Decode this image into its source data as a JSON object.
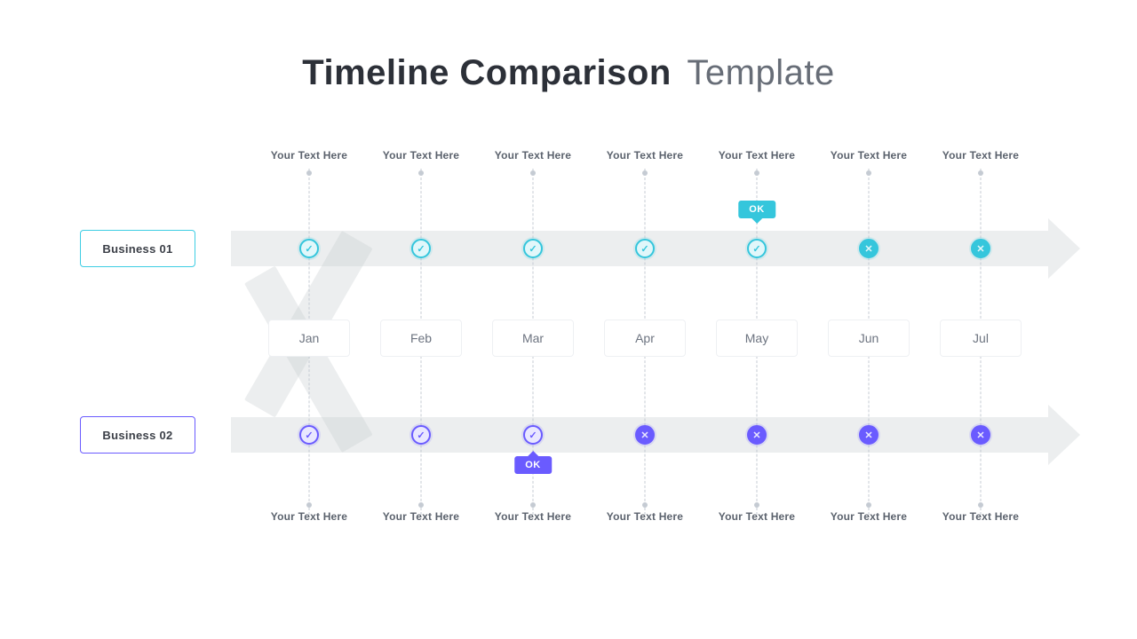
{
  "title": {
    "bold": "Timeline Comparison",
    "light": "Template"
  },
  "business1_label": "Business 01",
  "business2_label": "Business 02",
  "tooltip_ok": "OK",
  "tooltip_top_index": 4,
  "tooltip_bottom_index": 2,
  "columns": [
    {
      "month": "Jan",
      "top_text": "Your Text Here",
      "bot_text": "Your Text Here",
      "top_status": "check",
      "bot_status": "check"
    },
    {
      "month": "Feb",
      "top_text": "Your Text Here",
      "bot_text": "Your Text Here",
      "top_status": "check",
      "bot_status": "check"
    },
    {
      "month": "Mar",
      "top_text": "Your Text Here",
      "bot_text": "Your Text Here",
      "top_status": "check",
      "bot_status": "check"
    },
    {
      "month": "Apr",
      "top_text": "Your Text Here",
      "bot_text": "Your Text Here",
      "top_status": "check",
      "bot_status": "cross"
    },
    {
      "month": "May",
      "top_text": "Your Text Here",
      "bot_text": "Your Text Here",
      "top_status": "check",
      "bot_status": "cross"
    },
    {
      "month": "Jun",
      "top_text": "Your Text Here",
      "bot_text": "Your Text Here",
      "top_status": "cross",
      "bot_status": "cross"
    },
    {
      "month": "Jul",
      "top_text": "Your Text Here",
      "bot_text": "Your Text Here",
      "top_status": "cross",
      "bot_status": "cross"
    }
  ],
  "colors": {
    "cyan": "#35c6dc",
    "purple": "#6a5bff",
    "text": "#3b3f47"
  }
}
